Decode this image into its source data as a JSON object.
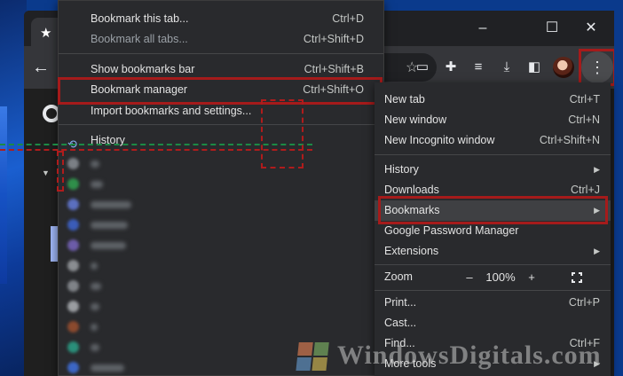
{
  "window": {
    "tab_icon": "star-icon",
    "controls": {
      "minimize": "–",
      "maximize": "☐",
      "close": "✕"
    }
  },
  "toolbar": {
    "back_icon": "arrow-left-icon",
    "icons": [
      "bookmark-star-icon",
      "chat-icon",
      "puzzle-extensions-icon",
      "media-playlist-icon",
      "download-icon",
      "side-panel-icon",
      "profile-avatar-icon",
      "three-dot-menu-icon"
    ]
  },
  "bookmarks_submenu": {
    "items": [
      {
        "label": "Bookmark this tab...",
        "shortcut": "Ctrl+D"
      },
      {
        "label": "Bookmark all tabs...",
        "shortcut": "Ctrl+Shift+D"
      },
      {
        "label": "Show bookmarks bar",
        "shortcut": "Ctrl+Shift+B"
      },
      {
        "label": "Bookmark manager",
        "shortcut": "Ctrl+Shift+O"
      },
      {
        "label": "Import bookmarks and settings...",
        "shortcut": ""
      },
      {
        "label": "History",
        "shortcut": ""
      }
    ]
  },
  "chrome_menu": {
    "items": [
      {
        "label": "New tab",
        "shortcut": "Ctrl+T"
      },
      {
        "label": "New window",
        "shortcut": "Ctrl+N"
      },
      {
        "label": "New Incognito window",
        "shortcut": "Ctrl+Shift+N"
      },
      {
        "label": "History",
        "shortcut": ""
      },
      {
        "label": "Downloads",
        "shortcut": "Ctrl+J"
      },
      {
        "label": "Bookmarks",
        "shortcut": ""
      },
      {
        "label": "Google Password Manager",
        "shortcut": ""
      },
      {
        "label": "Extensions",
        "shortcut": ""
      },
      {
        "label": "Print...",
        "shortcut": "Ctrl+P"
      },
      {
        "label": "Cast...",
        "shortcut": ""
      },
      {
        "label": "Find...",
        "shortcut": "Ctrl+F"
      },
      {
        "label": "More tools",
        "shortcut": ""
      }
    ],
    "zoom": {
      "label": "Zoom",
      "minus": "–",
      "value": "100%",
      "plus": "+"
    }
  },
  "watermark": {
    "text": "WindowsDigitals.com"
  },
  "colors": {
    "highlight": "#a51b1b",
    "menu_bg": "#292a2d",
    "accent_blue": "#8ab4f8"
  }
}
